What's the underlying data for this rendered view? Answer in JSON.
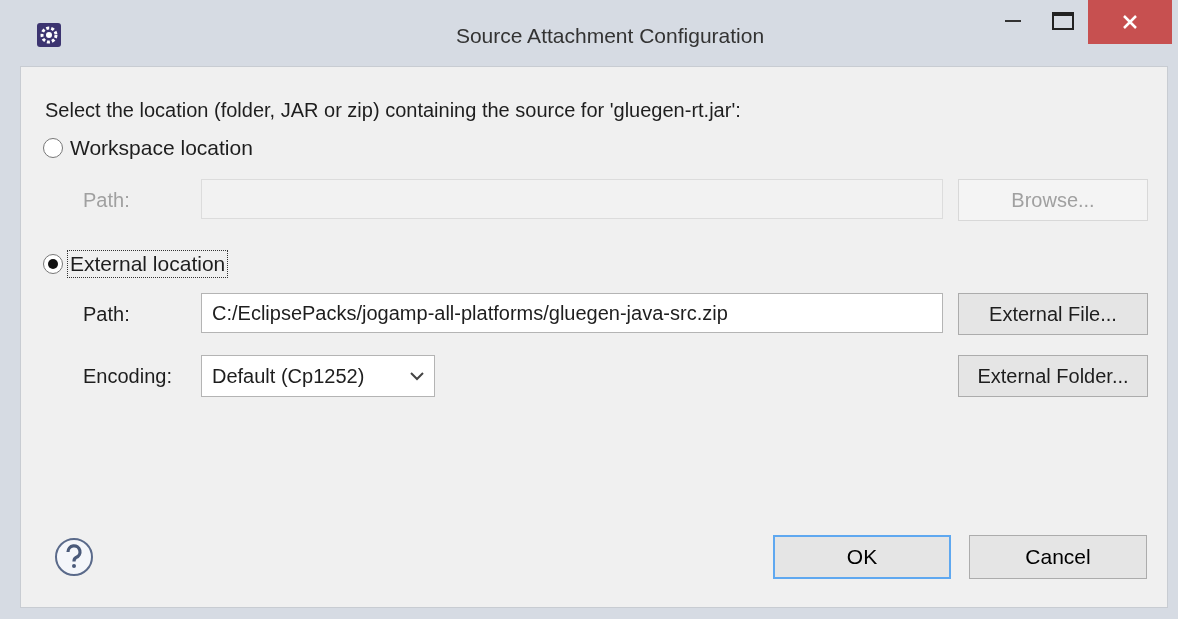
{
  "window": {
    "title": "Source Attachment Configuration"
  },
  "prompt": "Select the location (folder, JAR or zip) containing the source for 'gluegen-rt.jar':",
  "options": [
    {
      "label": "Workspace location",
      "selected": false,
      "focused": false,
      "rows": [
        {
          "label": "Path:",
          "kind": "text",
          "value": "",
          "disabled": true,
          "button": {
            "label": "Browse...",
            "disabled": true
          }
        }
      ]
    },
    {
      "label": "External location",
      "selected": true,
      "focused": true,
      "rows": [
        {
          "label": "Path:",
          "kind": "text",
          "value": "C:/EclipsePacks/jogamp-all-platforms/gluegen-java-src.zip",
          "disabled": false,
          "button": {
            "label": "External File...",
            "disabled": false
          }
        },
        {
          "label": "Encoding:",
          "kind": "select",
          "value": "Default (Cp1252)",
          "disabled": false,
          "button": {
            "label": "External Folder...",
            "disabled": false
          }
        }
      ]
    }
  ],
  "buttons": [
    {
      "label": "OK",
      "default": true
    },
    {
      "label": "Cancel",
      "default": false
    }
  ]
}
